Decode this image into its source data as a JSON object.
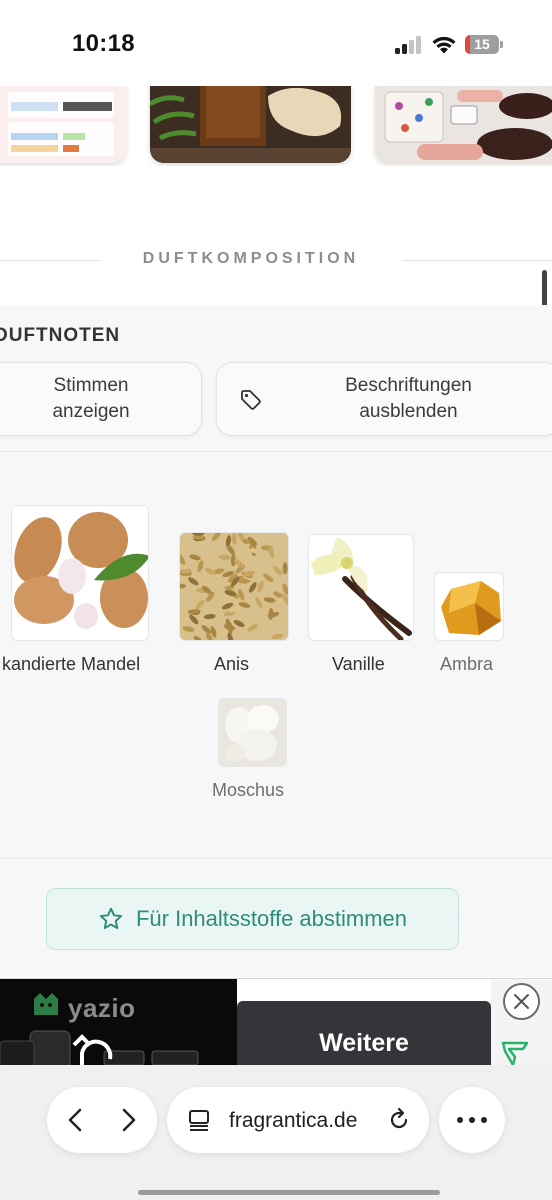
{
  "status_bar": {
    "time": "10:18",
    "battery_level": "15",
    "battery_fraction": 0.15
  },
  "carousel": {
    "items": [
      "card-1",
      "card-2",
      "card-3"
    ]
  },
  "section": {
    "title": "DUFTKOMPOSITION"
  },
  "panel": {
    "heading": "DUFTNOTEN",
    "votes_button": {
      "line1": "Stimmen",
      "line2": "anzeigen"
    },
    "labels_button": {
      "line1": "Beschriftungen",
      "line2": "ausblenden"
    },
    "notes": [
      {
        "label": "kandierte Mandel",
        "icon": "almond"
      },
      {
        "label": "Anis",
        "icon": "anise"
      },
      {
        "label": "Vanille",
        "icon": "vanilla"
      },
      {
        "label": "Ambra",
        "icon": "amber"
      },
      {
        "label": "Moschus",
        "icon": "musk"
      }
    ],
    "vote_button_label": "Für Inhaltsstoffe abstimmen"
  },
  "ad": {
    "brand": "yazio",
    "cta_label": "Weitere"
  },
  "browser": {
    "url": "fragrantica.de"
  },
  "colors": {
    "accent": "#2f8c7c",
    "battery": "#e2473f"
  }
}
